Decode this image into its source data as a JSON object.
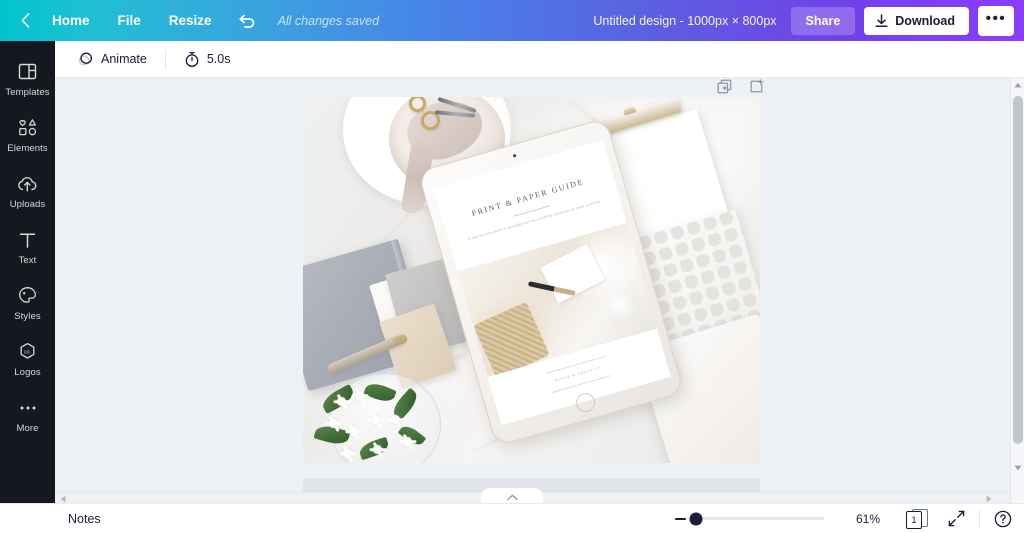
{
  "topbar": {
    "back_icon": "chevron-left-icon",
    "home_label": "Home",
    "file_label": "File",
    "resize_label": "Resize",
    "undo_icon": "undo-icon",
    "save_status": "All changes saved",
    "design_title": "Untitled design - 1000px × 800px",
    "share_label": "Share",
    "download_icon": "download-icon",
    "download_label": "Download",
    "more_label": "•••",
    "gradient_start": "#00c4cc",
    "gradient_end": "#8b3dff"
  },
  "sidebar": {
    "items": [
      {
        "label": "Templates",
        "icon": "templates-icon"
      },
      {
        "label": "Elements",
        "icon": "elements-icon"
      },
      {
        "label": "Uploads",
        "icon": "uploads-icon"
      },
      {
        "label": "Text",
        "icon": "text-icon"
      },
      {
        "label": "Styles",
        "icon": "styles-icon"
      },
      {
        "label": "Logos",
        "icon": "logos-icon"
      },
      {
        "label": "More",
        "icon": "more-dots-icon"
      }
    ],
    "background": "#15181f"
  },
  "toolbar": {
    "animate_label": "Animate",
    "animate_icon": "animate-circles-icon",
    "duration_label": "5.0s",
    "duration_icon": "stopwatch-icon"
  },
  "canvas": {
    "duplicate_page_icon": "duplicate-page-icon",
    "add_page_icon": "add-page-icon",
    "background": "#edf0f4",
    "design": {
      "scene_description": "Flat-lay photo: white marble desk with tablet mockup, gold scissors on ceramic plate, grey notebook, paper swatches, white flowers, clipboard and white leather portfolio",
      "tablet_screen": {
        "title": "PRINT & PAPER GUIDE",
        "subtitle": "A step-by-step guide to printing your own wedding stationery at home or online",
        "footer_text": "PAPER &  PRESS CO"
      }
    }
  },
  "scrollbars": {
    "vertical_up_icon": "scroll-up-arrow-icon",
    "vertical_down_icon": "scroll-down-arrow-icon",
    "horizontal_left_icon": "scroll-left-arrow-icon",
    "horizontal_right_icon": "scroll-right-arrow-icon"
  },
  "collapse_tab": {
    "icon": "chevron-up-icon"
  },
  "bottombar": {
    "notes_label": "Notes",
    "zoom_minus_icon": "minus-icon",
    "zoom_percent": "61%",
    "page_count": "1",
    "page_count_icon": "pages-icon",
    "fullscreen_icon": "expand-icon",
    "help_icon": "help-circle-icon"
  }
}
